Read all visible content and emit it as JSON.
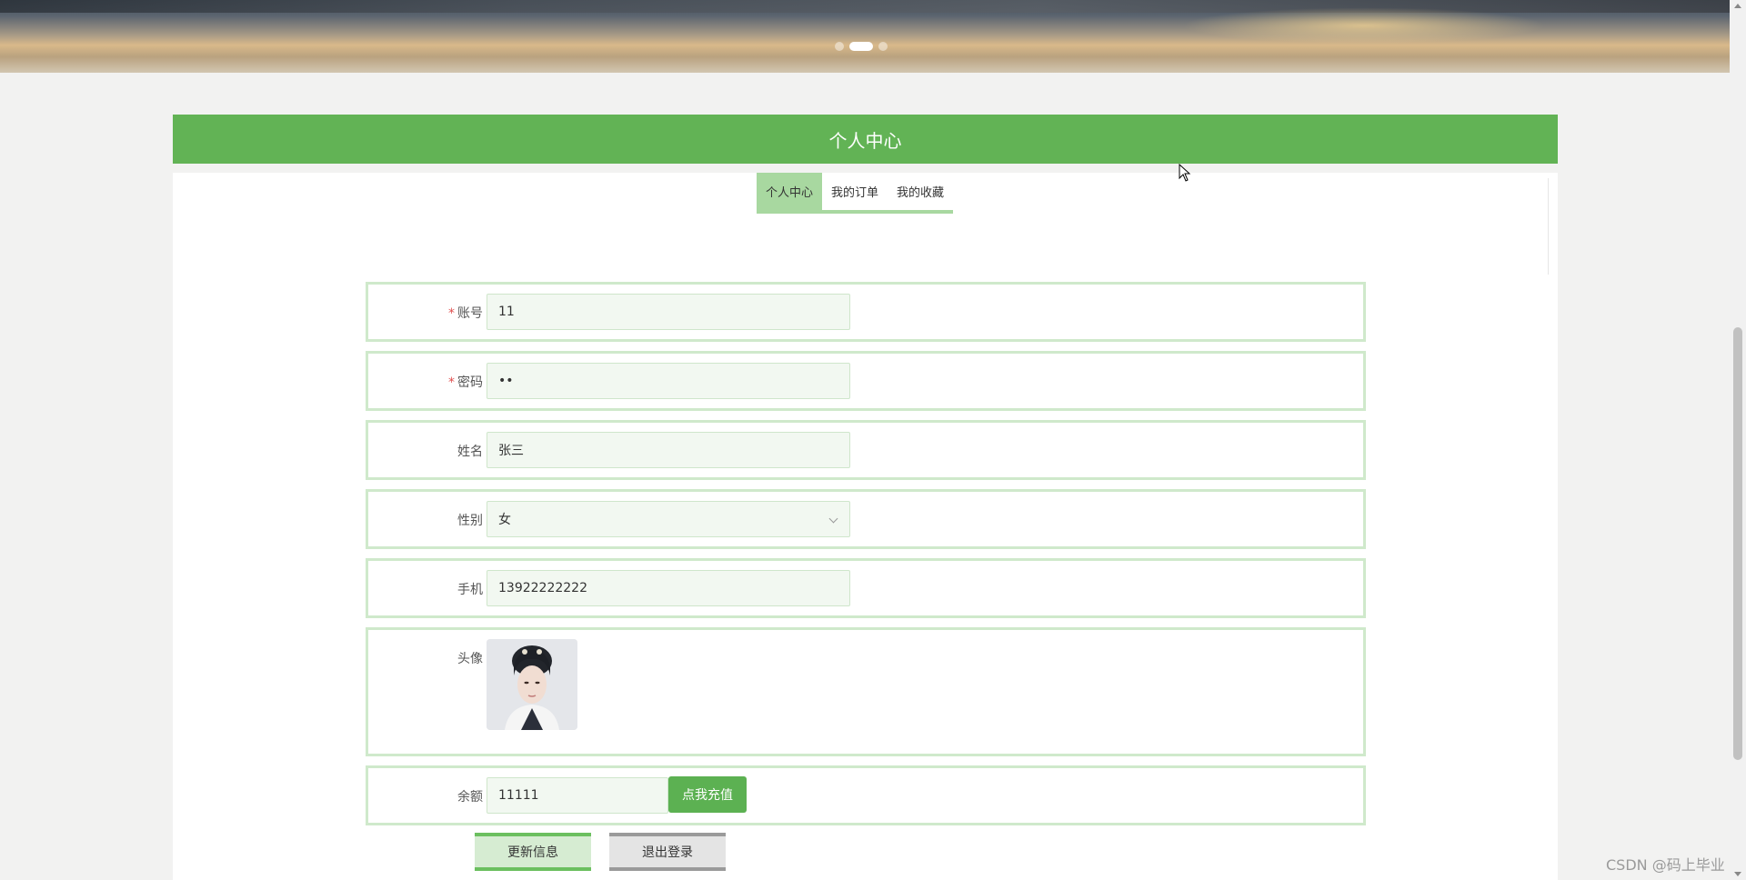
{
  "banner": {
    "slide_count": 3,
    "active_slide": 2
  },
  "section": {
    "title": "个人中心"
  },
  "tabs": [
    {
      "label": "个人中心",
      "active": true
    },
    {
      "label": "我的订单",
      "active": false
    },
    {
      "label": "我的收藏",
      "active": false
    }
  ],
  "form": {
    "account": {
      "label": "账号",
      "required": "*",
      "value": "11"
    },
    "password": {
      "label": "密码",
      "required": "*",
      "value": "••"
    },
    "name": {
      "label": "姓名",
      "value": "张三"
    },
    "gender": {
      "label": "性别",
      "value": "女"
    },
    "phone": {
      "label": "手机",
      "value": "13922222222"
    },
    "avatar": {
      "label": "头像"
    },
    "balance": {
      "label": "余额",
      "value": "11111",
      "recharge_label": "点我充值"
    }
  },
  "actions": {
    "update_label": "更新信息",
    "logout_label": "退出登录"
  },
  "watermark": "CSDN @码上毕业",
  "colors": {
    "primary": "#62b355",
    "tab_active": "#a8d8a0",
    "row_border": "#cfe9cb"
  }
}
